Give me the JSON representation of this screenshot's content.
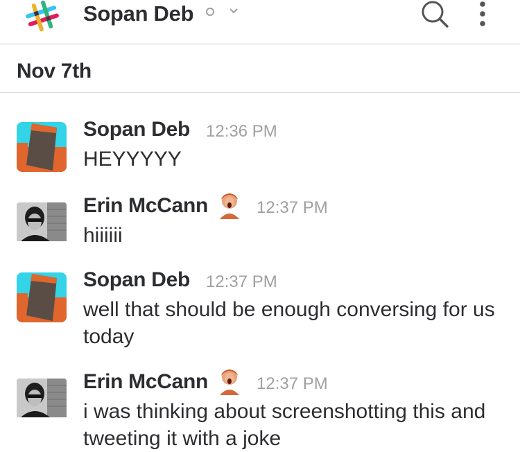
{
  "header": {
    "title": "Sopan Deb",
    "icons": [
      "slack-logo",
      "presence-away-icon",
      "chevron-down-icon",
      "search-icon",
      "more-vertical-icon"
    ]
  },
  "day_divider": {
    "date": "Nov 7th"
  },
  "messages": [
    {
      "author": "Sopan Deb",
      "time": "12:36 PM",
      "text": "HEYYYYY",
      "avatar": "sopan-avatar"
    },
    {
      "author": "Erin McCann",
      "time": "12:37 PM",
      "text": "hiiiiii",
      "avatar": "erin-avatar",
      "status_emoji": "custom-emoji"
    },
    {
      "author": "Sopan Deb",
      "time": "12:37 PM",
      "text": "well that should be enough conversing for us today",
      "avatar": "sopan-avatar"
    },
    {
      "author": "Erin McCann",
      "time": "12:37 PM",
      "text": "i was thinking about screenshotting this and tweeting it with a joke",
      "avatar": "erin-avatar",
      "status_emoji": "custom-emoji"
    }
  ],
  "colors": {
    "text": "#2c2d30",
    "muted": "#a0a0a2",
    "divider": "#cfcfd1",
    "avatar_cyan": "#33d4e8",
    "avatar_orange": "#e0662e",
    "avatar_dark": "#5a4d45"
  }
}
